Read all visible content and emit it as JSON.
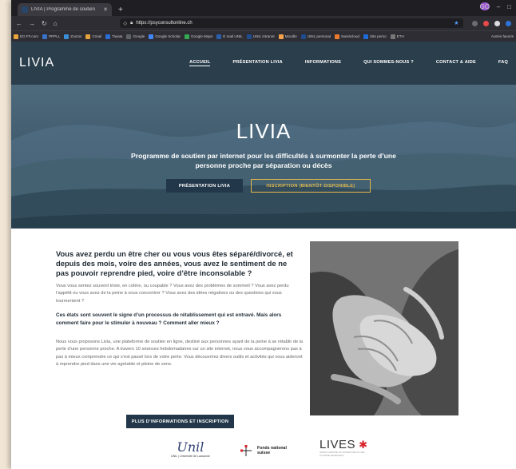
{
  "browser": {
    "tab_title": "LIVIA | Programme de soutien",
    "url": "https://psyconsultonline.ch",
    "profile_badge": "GO",
    "bookmarks": [
      {
        "label": "EG FF.com",
        "color": "#e9a43a"
      },
      {
        "label": "PPPLL",
        "color": "#3a72c8"
      },
      {
        "label": "Zooms",
        "color": "#3a8fd8"
      },
      {
        "label": "Cmail",
        "color": "#e5a13c"
      },
      {
        "label": "Tiwata",
        "color": "#2b6fd6"
      },
      {
        "label": "Google",
        "color": "#5f6368"
      },
      {
        "label": "Google Scholar",
        "color": "#4285f4"
      },
      {
        "label": "Google Maps",
        "color": "#34a853"
      },
      {
        "label": "E mail UNIL",
        "color": "#2c5fab"
      },
      {
        "label": "UNIL intranet",
        "color": "#1d4c8f"
      },
      {
        "label": "Moodle",
        "color": "#f6a14b"
      },
      {
        "label": "UNIL personal",
        "color": "#1d4c8f"
      },
      {
        "label": "Swisscloud",
        "color": "#e87b2e"
      },
      {
        "label": "Site perso",
        "color": "#1d6bd6"
      },
      {
        "label": "ETH",
        "color": "#777777"
      }
    ],
    "other_bookmarks": "Autres favoris"
  },
  "site": {
    "logo": "LIVIA",
    "menu": [
      "ACCUEIL",
      "PRÉSENTATION LIVIA",
      "INFORMATIONS",
      "QUI SOMMES-NOUS ?",
      "CONTACT & AIDE",
      "FAQ"
    ]
  },
  "hero": {
    "title": "LIVIA",
    "subtitle": "Programme de soutien par internet pour les difficultés à surmonter la perte d’une personne proche par séparation ou décès",
    "btn_presentation": "PRÉSENTATION LIVIA",
    "btn_inscription": "INSCRIPTION (BIENTÔT DISPONIBLE)"
  },
  "main": {
    "heading": "Vous avez perdu un être cher ou vous vous êtes séparé/divorcé, et depuis des mois, voire des années, vous avez le sentiment de ne pas pouvoir reprendre pied, voire d’être inconsolable ?",
    "para1": "Vous vous sentez souvent triste, en colère, ou coupable ? Vous avez des problèmes de sommeil ? Vous avez perdu l’appétit ou vous avez de la peine à vous concentrer ? Vous avez des idées négatives ou des questions qui vous tourmentent ?",
    "para2": "Ces états sont souvent le signe d’un processus de rétablissement qui est entravé.  Mais alors comment faire pour le stimuler à nouveau ? Comment aller mieux ?",
    "para3": "Nous vous proposons Livia, une plateforme de soutien en ligne, destiné aux personnes ayant de la peine à se rétablir de la perte d’une personne proche. A travers 10 séances hebdomadaires sur un site internet, nous vous accompagnerons pas à pas à mieux comprendre ce qui s’est passé lors de votre perte. Vous découvrirez divers outils et activités qui vous aideront à reprendre pied dans une vie agréable et pleine de sens.",
    "cta": "PLUS D’INFORMATIONS ET INSCRIPTION"
  },
  "partners": {
    "unil_word": "Unil",
    "unil_sub": "UNIL | Université de Lausanne",
    "fns_line1": "Fonds national",
    "fns_line2": "suisse",
    "lives_word": "LIVES",
    "lives_sub": "SWISS CENTRE OF EXPERTISE IN LIFE COURSE RESEARCH"
  }
}
